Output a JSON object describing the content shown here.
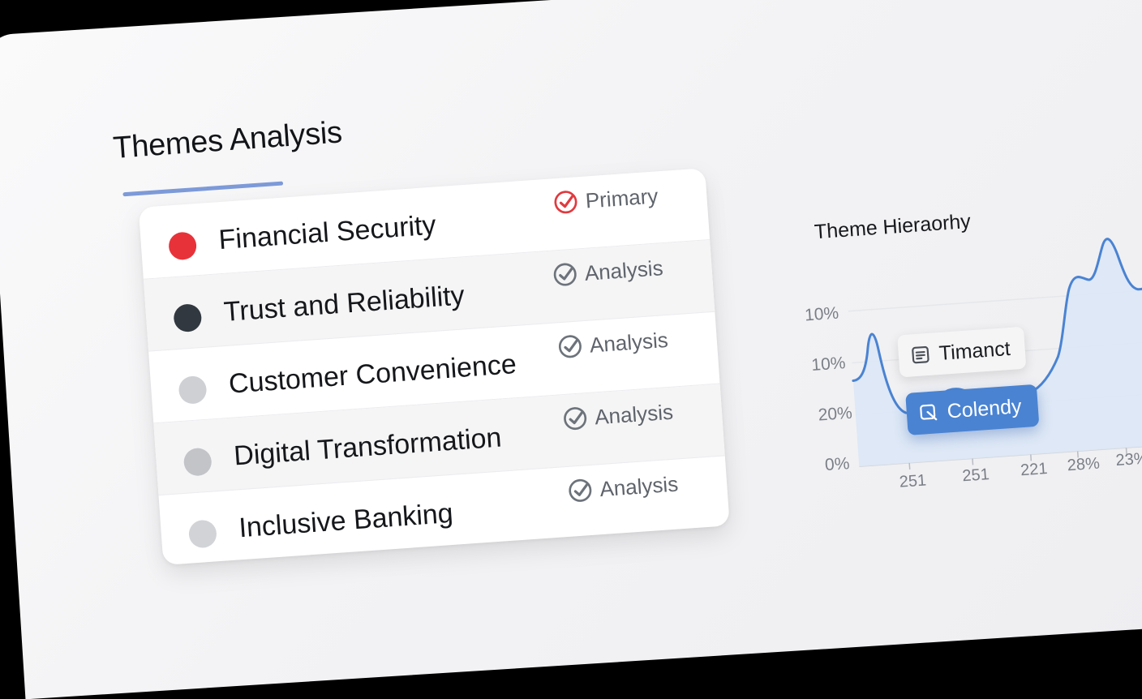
{
  "page": {
    "title": "Themes Analysis"
  },
  "themes": [
    {
      "label": "Financial Security",
      "tag": "Primary",
      "dot_color": "#e8323a",
      "tag_color": "#e03a3f"
    },
    {
      "label": "Trust and Reliability",
      "tag": "Analysis",
      "dot_color": "#323840",
      "tag_color": "#6d737b"
    },
    {
      "label": "Customer Convenience",
      "tag": "Analysis",
      "dot_color": "#cfd0d4",
      "tag_color": "#6d737b"
    },
    {
      "label": "Digital Transformation",
      "tag": "Analysis",
      "dot_color": "#c2c4c8",
      "tag_color": "#6d737b"
    },
    {
      "label": "Inclusive Banking",
      "tag": "Analysis",
      "dot_color": "#d2d3d7",
      "tag_color": "#6d737b"
    }
  ],
  "chart_data": {
    "type": "area",
    "title": "Theme Hieraorhy",
    "y_tick_labels": [
      "10%",
      "10%",
      "20%",
      "0%"
    ],
    "x_tick_labels": [
      "251",
      "251",
      "221",
      "28%",
      "23%"
    ],
    "series_color": "#4a83d2",
    "fill_color": "#dce7f6",
    "grid": true,
    "tooltips": [
      {
        "label": "Timanct",
        "icon": "list-icon",
        "style": "light"
      },
      {
        "label": "Colendy",
        "icon": "edit-icon",
        "style": "blue"
      }
    ]
  }
}
